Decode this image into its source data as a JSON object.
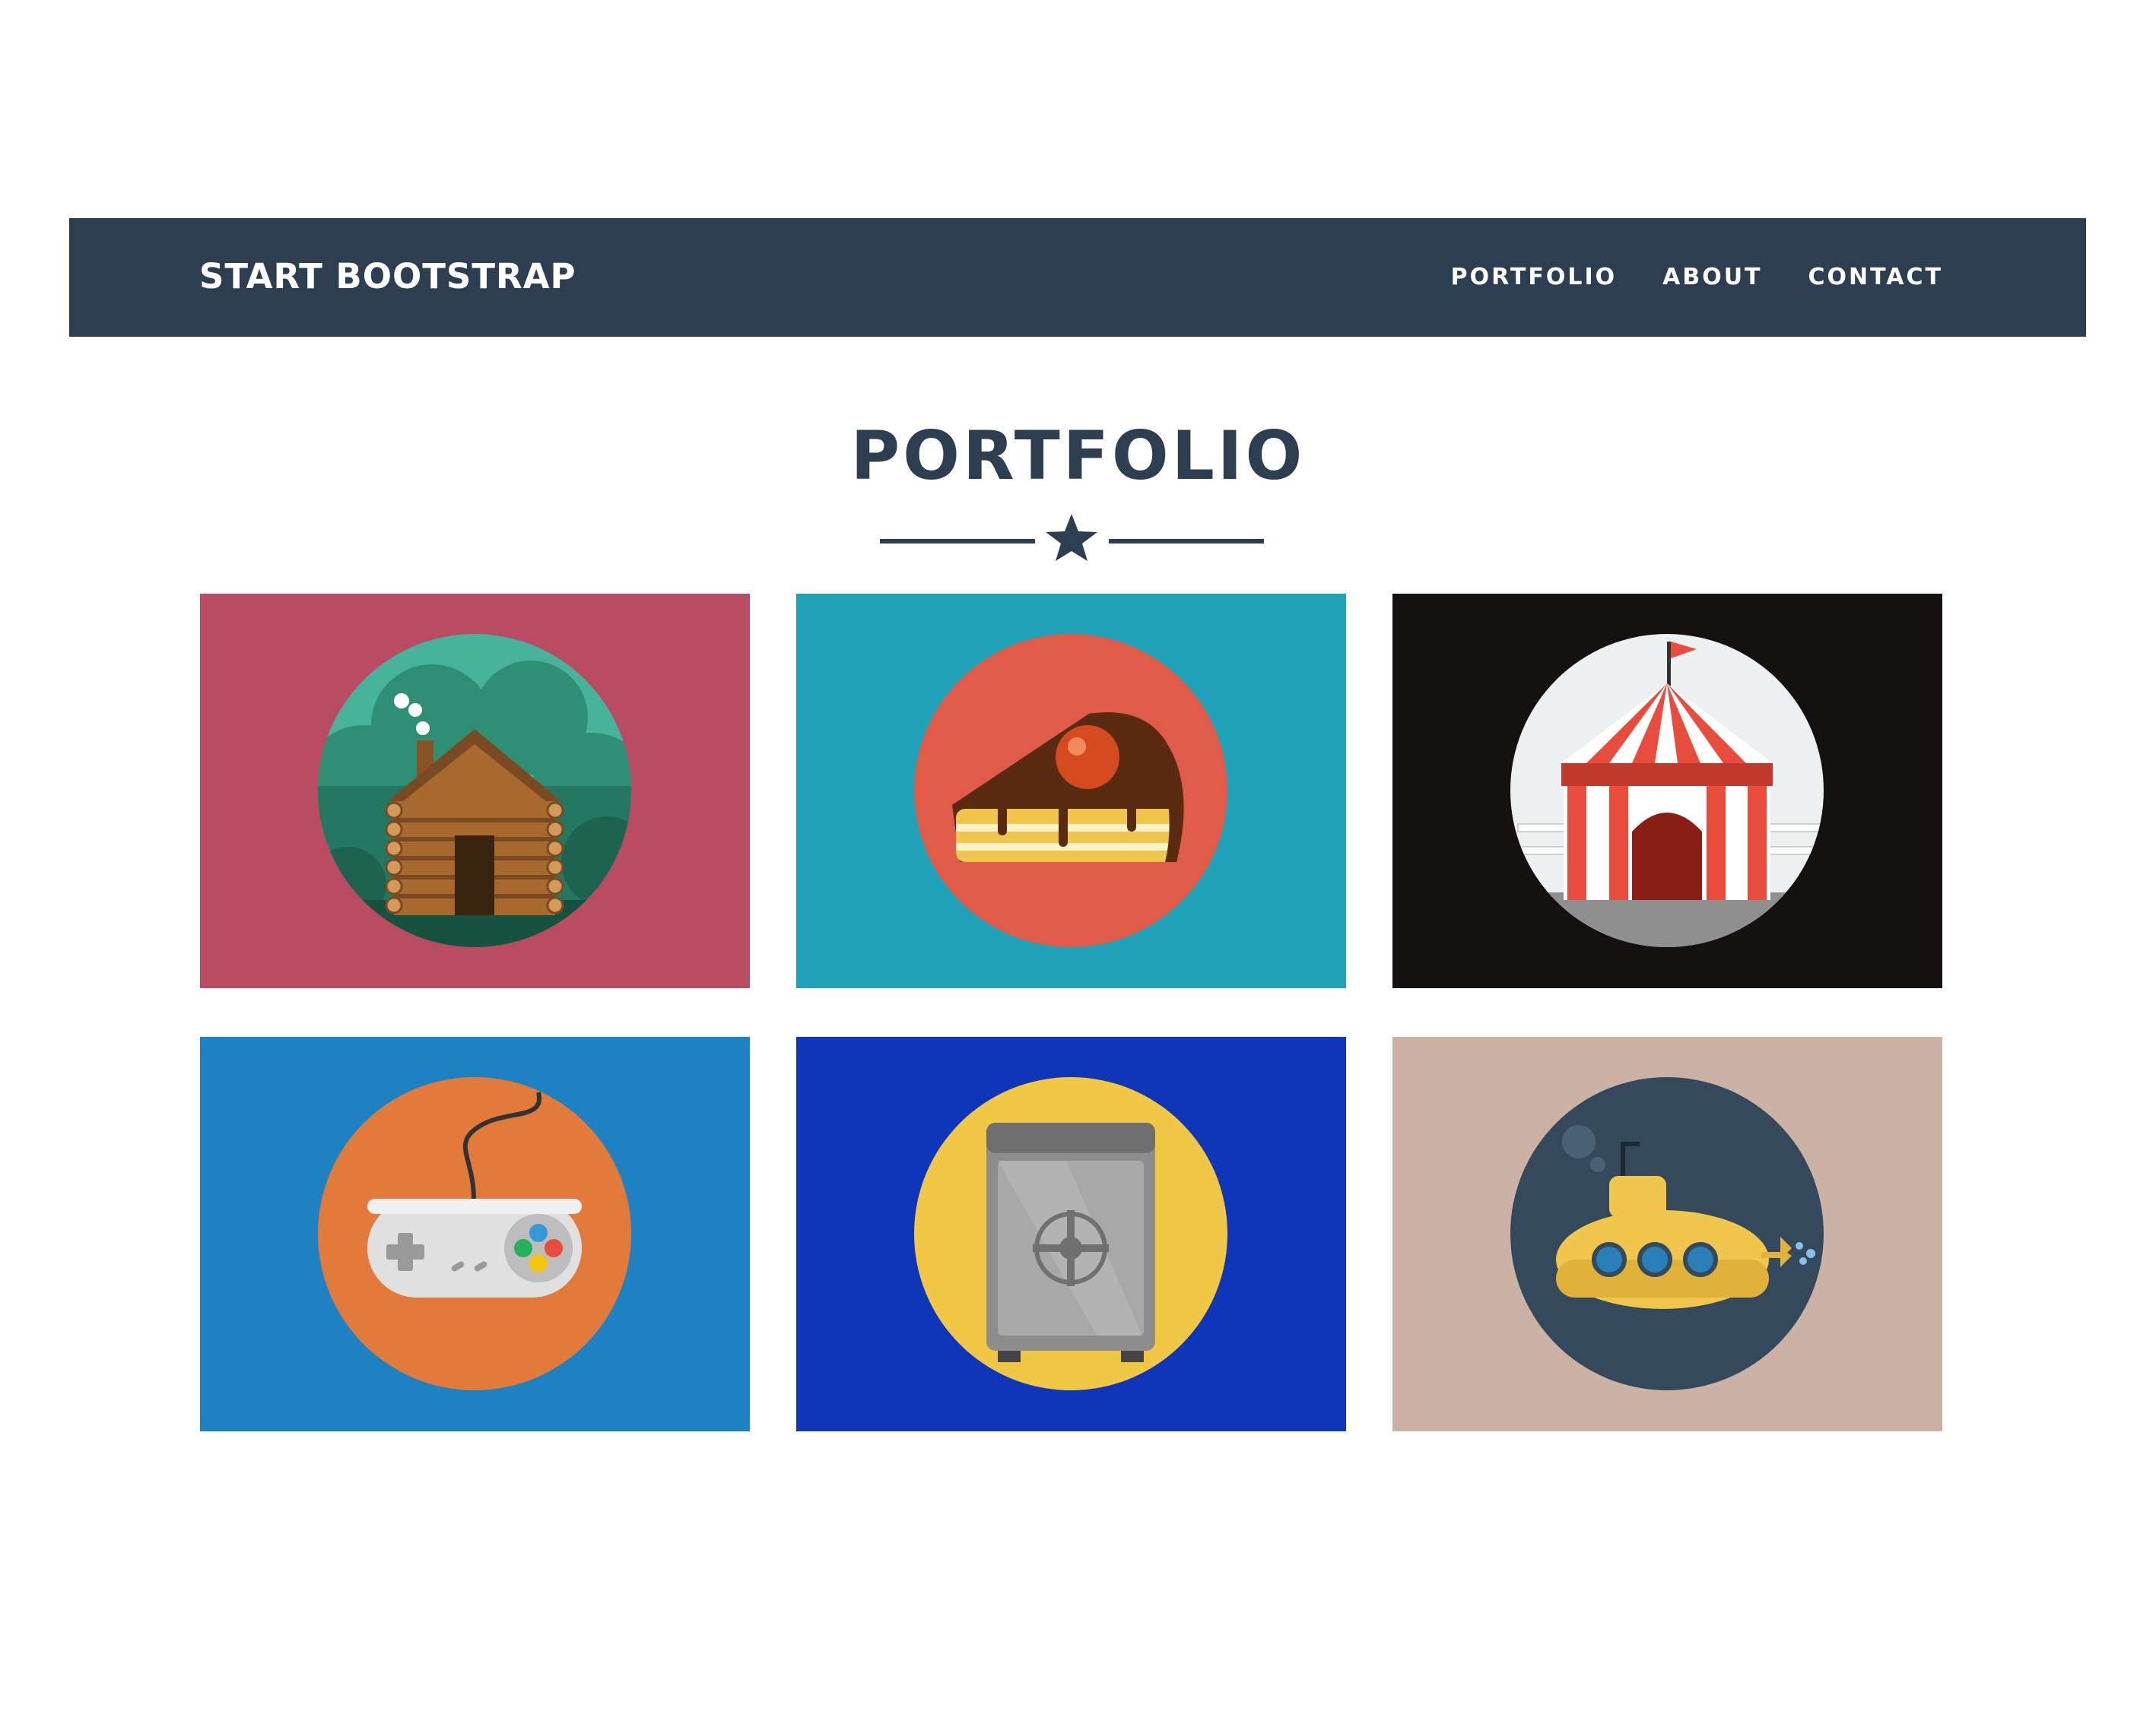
{
  "navbar": {
    "brand": "START BOOTSTRAP",
    "links": [
      "PORTFOLIO",
      "ABOUT",
      "CONTACT"
    ],
    "background": "#2c3e50"
  },
  "section": {
    "title": "PORTFOLIO",
    "divider_icon": "star-icon"
  },
  "portfolio": {
    "items": [
      {
        "icon": "cabin-icon",
        "background": "#b94b63",
        "circle": "#2f8f74"
      },
      {
        "icon": "cake-icon",
        "background": "#20a3b8",
        "circle": "#e05c48"
      },
      {
        "icon": "circus-tent-icon",
        "background": "#141110",
        "circle": "#eeeeee"
      },
      {
        "icon": "game-controller-icon",
        "background": "#1e82c2",
        "circle": "#e27a3c"
      },
      {
        "icon": "safe-icon",
        "background": "#0f36b8",
        "circle": "#f0c845"
      },
      {
        "icon": "submarine-icon",
        "background": "#ccb2a4",
        "circle": "#344a5c"
      }
    ]
  }
}
